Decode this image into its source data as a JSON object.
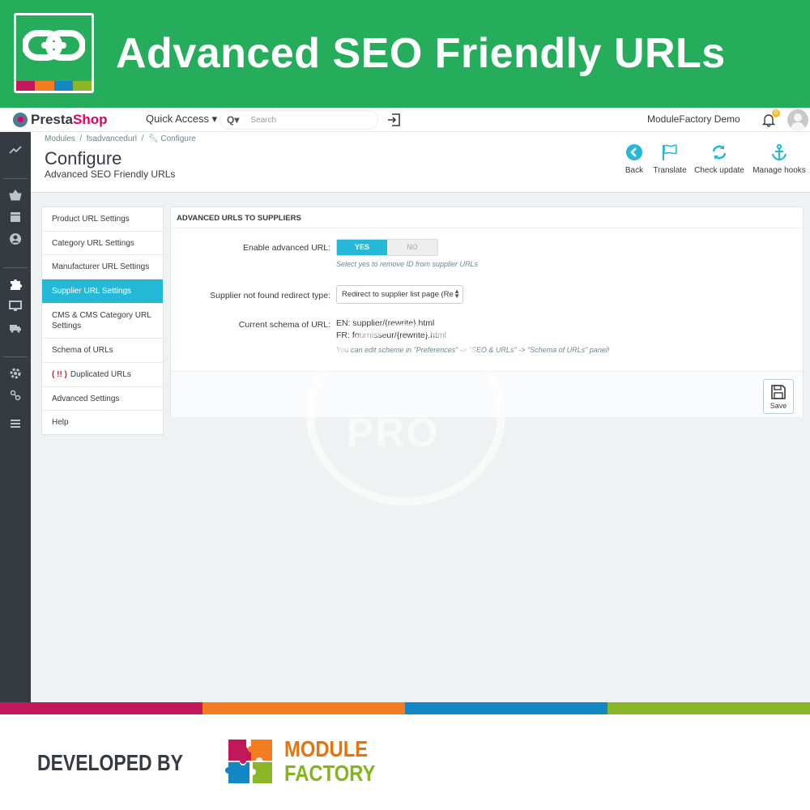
{
  "banner": {
    "title": "Advanced SEO Friendly URLs",
    "icon": "link-icon",
    "strip_colors": [
      "#c2185b",
      "#f47c20",
      "#1287c4",
      "#8bb629"
    ]
  },
  "topbar": {
    "brand_a": "Presta",
    "brand_b": "Shop",
    "quick_access": "Quick Access ▾",
    "search_prefix": "Q▾",
    "search_placeholder": "Search",
    "user": "ModuleFactory Demo",
    "notifications": "0"
  },
  "header": {
    "breadcrumb": [
      "Modules",
      "fsadvancedurl",
      "Configure"
    ],
    "title": "Configure",
    "subtitle": "Advanced SEO Friendly URLs",
    "toolbar": {
      "back": "Back",
      "translate": "Translate",
      "check_update": "Check update",
      "manage_hooks": "Manage hooks"
    }
  },
  "menu": {
    "items": [
      "Product URL Settings",
      "Category URL Settings",
      "Manufacturer URL Settings",
      "Supplier URL Settings",
      "CMS & CMS Category URL Settings",
      "Schema of URLs",
      "Duplicated URLs",
      "Advanced Settings",
      "Help"
    ],
    "warning_prefix": "( !! )",
    "active_index": 3
  },
  "panel": {
    "heading": "ADVANCED URLS TO SUPPLIERS",
    "enable_label": "Enable advanced URL:",
    "yes": "YES",
    "no": "NO",
    "enable_value": "YES",
    "enable_help": "Select yes to remove ID from supplier URLs",
    "redirect_label": "Supplier not found redirect type:",
    "redirect_value": "Redirect to supplier list page (Re",
    "schema_label": "Current schema of URL:",
    "schema_en": "EN: supplier/{rewrite}.html",
    "schema_fr": "FR: fournisseur/{rewrite}.html",
    "schema_help": "You can edit scheme in \"Preferences\" -> \"SEO & URLs\" -> \"Schema of URLs\" panel!",
    "save": "Save"
  },
  "watermark": "PRO",
  "footer": {
    "developed_by": "DEVELOPED BY",
    "brand_line1": "MODULE",
    "brand_line2": "FACTORY",
    "stripe_colors": [
      "#c2185b",
      "#f47c20",
      "#1287c4",
      "#8bb629"
    ]
  },
  "colors": {
    "banner_green": "#26ad5c",
    "accent": "#25b9d7",
    "sidebar": "#363a41"
  }
}
